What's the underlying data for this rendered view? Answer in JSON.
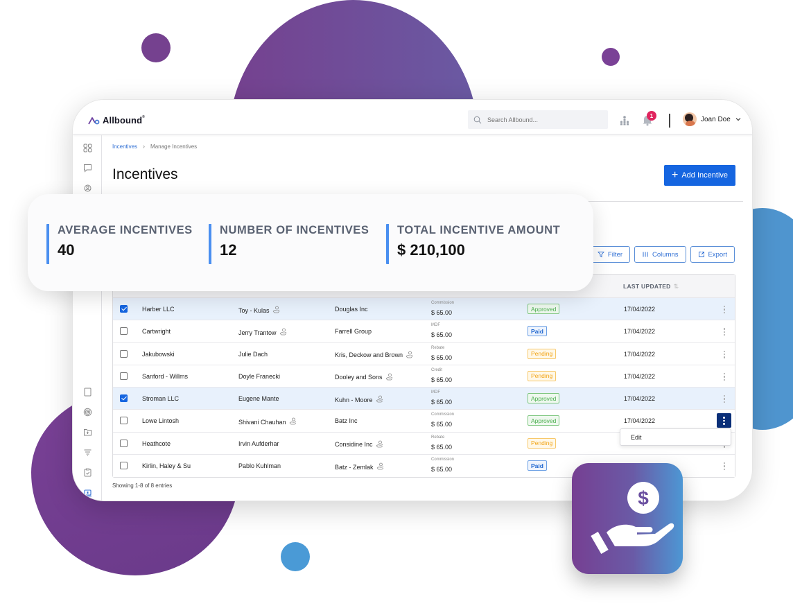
{
  "app": {
    "brand": "Allbound",
    "brand_mark": "®"
  },
  "header": {
    "search_placeholder": "Search Allbound...",
    "notification_count": "1",
    "user_name": "Joan Doe"
  },
  "sidebar": {
    "items": [
      {
        "icon": "dashboard-grid-icon"
      },
      {
        "icon": "chat-bubble-icon"
      },
      {
        "icon": "partners-icon"
      },
      {
        "icon": "document-icon"
      },
      {
        "icon": "target-icon"
      },
      {
        "icon": "folder-add-icon"
      },
      {
        "icon": "funnel-icon"
      },
      {
        "icon": "clipboard-check-icon"
      },
      {
        "icon": "laptop-icon",
        "active": true
      },
      {
        "icon": "incentive-hand-icon"
      }
    ]
  },
  "breadcrumb": {
    "parent": "Incentives",
    "current": "Manage Incentives"
  },
  "page": {
    "title": "Incentives",
    "add_button": "Add Incentive"
  },
  "stats": [
    {
      "label": "AVERAGE INCENTIVES",
      "value": "40"
    },
    {
      "label": "NUMBER OF INCENTIVES",
      "value": "12"
    },
    {
      "label": "TOTAL INCENTIVE AMOUNT",
      "value": "$ 210,100"
    }
  ],
  "toolbar": {
    "filter": "Filter",
    "columns": "Columns",
    "export": "Export"
  },
  "table": {
    "headers": {
      "last_updated": "LAST UPDATED"
    },
    "rows": [
      {
        "checked": true,
        "partner": "Harber LLC",
        "contact": "Toy - Kulas",
        "contact_icon": true,
        "account": "Douglas Inc",
        "account_icon": false,
        "type": "Commission",
        "amount": "$ 65.00",
        "status": "Approved",
        "date": "17/04/2022"
      },
      {
        "checked": false,
        "partner": "Cartwright",
        "contact": "Jerry Trantow",
        "contact_icon": true,
        "account": "Farrell Group",
        "account_icon": false,
        "type": "MDF",
        "amount": "$ 65.00",
        "status": "Paid",
        "date": "17/04/2022"
      },
      {
        "checked": false,
        "partner": "Jakubowski",
        "contact": "Julie Dach",
        "contact_icon": false,
        "account": "Kris, Deckow and Brown",
        "account_icon": true,
        "type": "Rebate",
        "amount": "$ 65.00",
        "status": "Pending",
        "date": "17/04/2022"
      },
      {
        "checked": false,
        "partner": "Sanford - Willms",
        "contact": "Doyle Franecki",
        "contact_icon": false,
        "account": "Dooley and Sons",
        "account_icon": true,
        "type": "Credit",
        "amount": "$ 65.00",
        "status": "Pending",
        "date": "17/04/2022"
      },
      {
        "checked": true,
        "partner": "Stroman LLC",
        "contact": "Eugene Mante",
        "contact_icon": false,
        "account": "Kuhn - Moore",
        "account_icon": true,
        "type": "MDF",
        "amount": "$ 65.00",
        "status": "Approved",
        "date": "17/04/2022"
      },
      {
        "checked": false,
        "partner": "Lowe Lintosh",
        "contact": "Shivani Chauhan",
        "contact_icon": true,
        "account": "Batz Inc",
        "account_icon": false,
        "type": "Commission",
        "amount": "$ 65.00",
        "status": "Approved",
        "date": "17/04/2022",
        "menu_open": true
      },
      {
        "checked": false,
        "partner": "Heathcote",
        "contact": "Irvin Aufderhar",
        "contact_icon": false,
        "account": "Considine Inc",
        "account_icon": true,
        "type": "Rebate",
        "amount": "$ 65.00",
        "status": "Pending",
        "date": ""
      },
      {
        "checked": false,
        "partner": "Kirlin, Haley & Su",
        "contact": "Pablo Kuhlman",
        "contact_icon": false,
        "account": "Batz - Zemlak",
        "account_icon": true,
        "type": "Commission",
        "amount": "$ 65.00",
        "status": "Paid",
        "date": "17/04/2022"
      }
    ],
    "row_menu": {
      "edit": "Edit"
    },
    "footer": "Showing 1-8 of 8 entries"
  },
  "colors": {
    "primary": "#1565e0",
    "accent_bar": "#4a8ff0",
    "brand_purple": "#75418f",
    "brand_blue": "#4f95cf",
    "approved": "#4caf50",
    "paid": "#1e66cf",
    "pending": "#f2a416",
    "notification": "#e0245e"
  }
}
